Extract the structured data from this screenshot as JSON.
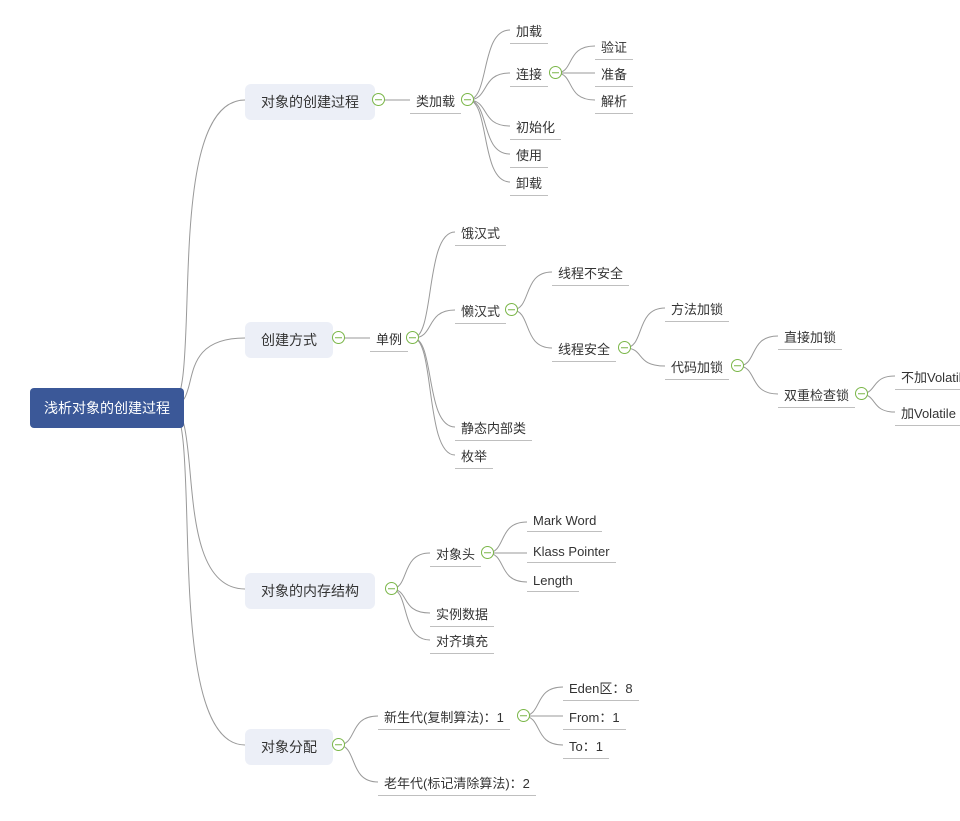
{
  "root": {
    "title": "浅析对象的创建过程"
  },
  "b1": {
    "title": "对象的创建过程",
    "n1": "类加载",
    "n1c": {
      "c1": "加载",
      "c2": "连接",
      "c2c": {
        "a": "验证",
        "b": "准备",
        "c": "解析"
      },
      "c3": "初始化",
      "c4": "使用",
      "c5": "卸载"
    }
  },
  "b2": {
    "title": "创建方式",
    "n1": "单例",
    "n1c": {
      "a": "饿汉式",
      "b": "懒汉式",
      "bc": {
        "a": "线程不安全",
        "b": "线程安全",
        "bc": {
          "a": "方法加锁",
          "b": "代码加锁",
          "bc": {
            "a": "直接加锁",
            "b": "双重检查锁",
            "bc": {
              "a": "不加Volatile",
              "b": "加Volatile"
            }
          }
        }
      },
      "c": "静态内部类",
      "d": "枚举"
    }
  },
  "b3": {
    "title": "对象的内存结构",
    "n1": "对象头",
    "n1c": {
      "a": "Mark Word",
      "b": "Klass Pointer",
      "c": "Length"
    },
    "n2": "实例数据",
    "n3": "对齐填充"
  },
  "b4": {
    "title": "对象分配",
    "n1": "新生代(复制算法)：1",
    "n1c": {
      "a": "Eden区：8",
      "b": "From：1",
      "c": "To：1"
    },
    "n2": "老年代(标记清除算法)：2"
  }
}
